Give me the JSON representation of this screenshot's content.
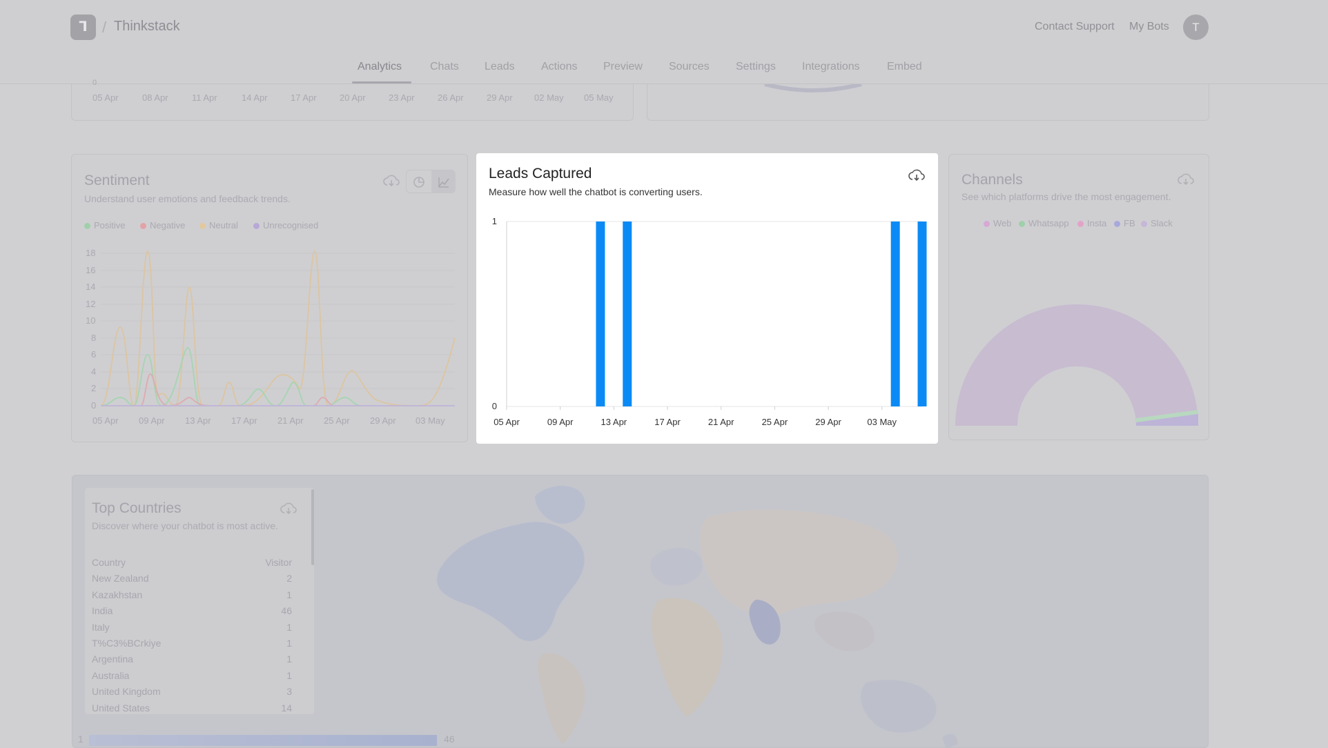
{
  "header": {
    "app_name": "Thinkstack",
    "breadcrumb_separator": "/",
    "contact_support": "Contact Support",
    "my_bots": "My Bots",
    "avatar_initial": "T",
    "logo_glyph": "ᒣ"
  },
  "tabs": [
    "Analytics",
    "Chats",
    "Leads",
    "Actions",
    "Preview",
    "Sources",
    "Settings",
    "Integrations",
    "Embed"
  ],
  "top_chart": {
    "zero_tick": "0",
    "x_ticks": [
      "05 Apr",
      "08 Apr",
      "11 Apr",
      "14 Apr",
      "17 Apr",
      "20 Apr",
      "23 Apr",
      "26 Apr",
      "29 Apr",
      "02 May",
      "05 May"
    ]
  },
  "sentiment": {
    "title": "Sentiment",
    "subtitle": "Understand user emotions and feedback trends.",
    "legend": [
      {
        "name": "Positive",
        "color": "#9fd0aa"
      },
      {
        "name": "Negative",
        "color": "#e2a3a8"
      },
      {
        "name": "Neutral",
        "color": "#e2c89e"
      },
      {
        "name": "Unrecognised",
        "color": "#b8a8d6"
      }
    ],
    "y_ticks": [
      "18",
      "16",
      "14",
      "12",
      "10",
      "8",
      "6",
      "4",
      "2",
      "0"
    ],
    "x_ticks": [
      "05 Apr",
      "09 Apr",
      "13 Apr",
      "17 Apr",
      "21 Apr",
      "25 Apr",
      "29 Apr",
      "03 May"
    ]
  },
  "leads": {
    "title": "Leads Captured",
    "subtitle": "Measure how well the chatbot is converting users.",
    "download_icon": "cloud-download-icon",
    "bar_color": "#0b8af5"
  },
  "chart_data": {
    "type": "bar",
    "title": "Leads Captured",
    "x_ticks": [
      "05 Apr",
      "09 Apr",
      "13 Apr",
      "17 Apr",
      "21 Apr",
      "25 Apr",
      "29 Apr",
      "03 May"
    ],
    "y_ticks": [
      "0",
      "1"
    ],
    "ylim": [
      0,
      1
    ],
    "xlim": [
      "05 Apr",
      "06 May"
    ],
    "x": [
      "12 Apr",
      "14 Apr",
      "04 May",
      "06 May"
    ],
    "values": [
      1,
      1,
      1,
      1
    ],
    "grid": true
  },
  "channels": {
    "title": "Channels",
    "subtitle": "See which platforms drive the most engagement.",
    "legend": [
      {
        "name": "Web",
        "color": "#d7a8d6"
      },
      {
        "name": "Whatsapp",
        "color": "#9fd0aa"
      },
      {
        "name": "Insta",
        "color": "#e2a3c8"
      },
      {
        "name": "FB",
        "color": "#a9a8dc"
      },
      {
        "name": "Slack",
        "color": "#c6b6d8"
      }
    ]
  },
  "countries": {
    "title": "Top Countries",
    "subtitle": "Discover where your chatbot is most active.",
    "col_country": "Country",
    "col_visitor": "Visitor",
    "rows": [
      {
        "country": "New Zealand",
        "visitors": "2"
      },
      {
        "country": "Kazakhstan",
        "visitors": "1"
      },
      {
        "country": "India",
        "visitors": "46"
      },
      {
        "country": "Italy",
        "visitors": "1"
      },
      {
        "country": "T%C3%BCrkiye",
        "visitors": "1"
      },
      {
        "country": "Argentina",
        "visitors": "1"
      },
      {
        "country": "Australia",
        "visitors": "1"
      },
      {
        "country": "United Kingdom",
        "visitors": "3"
      },
      {
        "country": "United States",
        "visitors": "14"
      }
    ],
    "scale_min": "1",
    "scale_max": "46"
  }
}
